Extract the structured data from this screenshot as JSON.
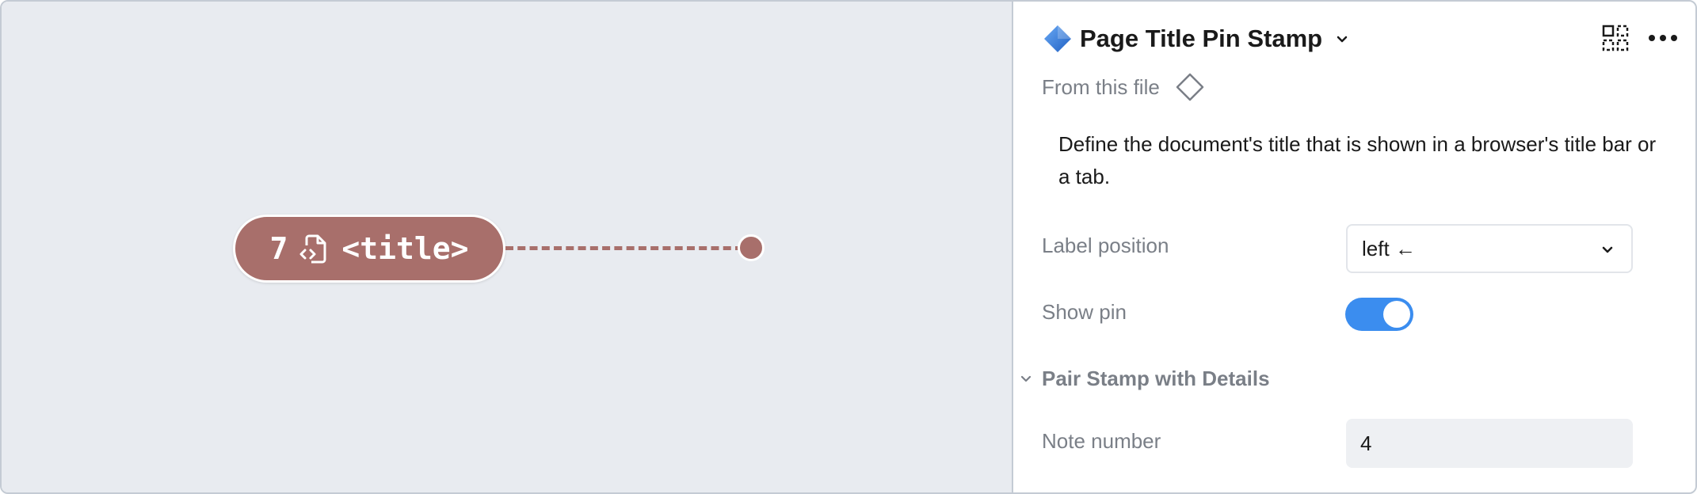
{
  "canvas": {
    "stamp": {
      "number": "7",
      "text": "<title>",
      "color": "#a86f6b",
      "icon": "file-code-icon"
    },
    "pin_color": "#a86f6b"
  },
  "panel": {
    "title": "Page Title Pin Stamp",
    "title_icon": "blue-diamond-icon",
    "source_label": "From this file",
    "source_icon": "component-diamond-icon",
    "description": "Define the document's title that is shown in a browser's title bar or a tab.",
    "label_position": {
      "label": "Label position",
      "value": "left ←"
    },
    "show_pin": {
      "label": "Show pin",
      "enabled": true
    },
    "section": {
      "title": "Pair Stamp with Details",
      "expanded": true
    },
    "note_number": {
      "label": "Note number",
      "value": "4"
    },
    "header_actions": [
      "select-matching-icon",
      "more-icon"
    ]
  },
  "colors": {
    "accent": "#3b8def",
    "canvas_bg": "#e8ebf0",
    "muted_text": "#7a7f87"
  }
}
